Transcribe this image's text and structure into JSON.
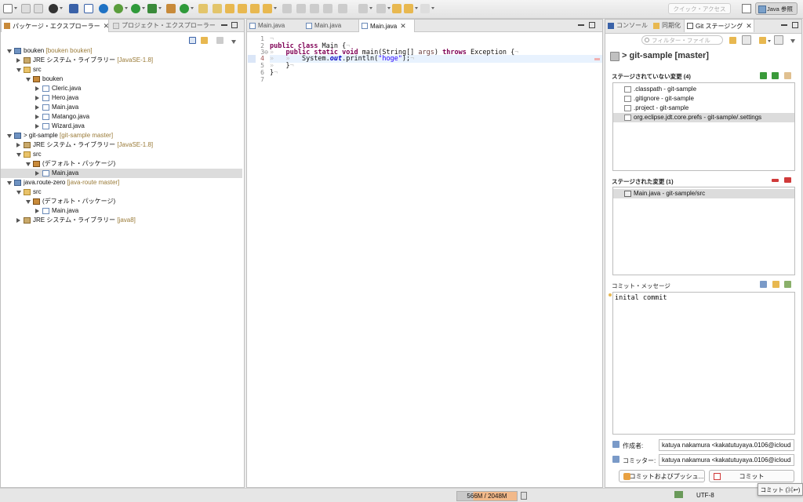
{
  "toolbar": {
    "quick_access": "クイック・アクセス",
    "perspective": "Java 参照"
  },
  "package_explorer": {
    "tab_label": "パッケージ・エクスプローラー",
    "other_tab_label": "プロジェクト・エクスプローラー",
    "tree": [
      {
        "label": "bouken",
        "decoration": " [bouken bouken]"
      },
      {
        "label": "JRE システム・ライブラリー",
        "decoration": " [JavaSE-1.8]"
      },
      {
        "label": "src"
      },
      {
        "label": "bouken"
      },
      {
        "label": "Cleric.java"
      },
      {
        "label": "Hero.java"
      },
      {
        "label": "Main.java"
      },
      {
        "label": "Matango.java"
      },
      {
        "label": "Wizard.java"
      },
      {
        "label": "> git-sample",
        "decoration": " [git-sample master]"
      },
      {
        "label": "JRE システム・ライブラリー",
        "decoration": " [JavaSE-1.8]"
      },
      {
        "label": "src"
      },
      {
        "label": "(デフォルト・パッケージ)"
      },
      {
        "label": "Main.java"
      },
      {
        "label": "java.route-zero",
        "decoration": " [java-route master]"
      },
      {
        "label": "src"
      },
      {
        "label": "(デフォルト・パッケージ)"
      },
      {
        "label": "Main.java"
      },
      {
        "label": "JRE システム・ライブラリー",
        "decoration": " [java8]"
      }
    ]
  },
  "editor": {
    "tabs": [
      "Main.java",
      "Main.java",
      "Main.java"
    ],
    "line_numbers": [
      "1",
      "2",
      "3⊖",
      "4",
      "5",
      "6",
      "7"
    ],
    "code": {
      "l2_kw1": "public",
      "l2_kw2": "class",
      "l2_rest": " Main {",
      "l3_kw1": "public",
      "l3_kw2": "static",
      "l3_kw3": "void",
      "l3_rest1": " main(String[] ",
      "l3_param": "args",
      "l3_rest2": ") ",
      "l3_kw4": "throws",
      "l3_rest3": " Exception {",
      "l4_pre": "System.",
      "l4_field": "out",
      "l4_mid": ".println(",
      "l4_str": "\"hoge\"",
      "l4_end": ");",
      "l5": "}",
      "l6": "}"
    }
  },
  "staging": {
    "tabs": [
      "コンソール",
      "同期化",
      "Git ステージング"
    ],
    "filter_placeholder": "フィルター・ファイル",
    "repo_title": "> git-sample [master]",
    "unstaged_header": "ステージされていない変更 (4)",
    "unstaged": [
      ".classpath - git-sample",
      ".gitignore - git-sample",
      ".project - git-sample",
      "org.eclipse.jdt.core.prefs - git-sample/.settings"
    ],
    "staged_header": "ステージされた変更 (1)",
    "staged": [
      "Main.java - git-sample/src"
    ],
    "commit_message_label": "コミット・メッセージ",
    "commit_message": "inital commit",
    "author_label": "作成者:",
    "author": "katuya nakamura <kakatutuyaya.0106@icloud",
    "committer_label": "コミッター:",
    "committer": "katuya nakamura <kakatutuyaya.0106@icloud",
    "commit_push_label": "コミットおよびプッシュ...",
    "commit_label": "コミット"
  },
  "status_bar": {
    "heap": "566M / 2048M",
    "encoding": "UTF-8",
    "tooltip": "コミット (⌘↩)"
  },
  "colors": {
    "keyword": "#7f0055",
    "string": "#2a00ff",
    "field": "#0000c0",
    "decoration": "#9a7b38",
    "current_line": "#e8f2fe"
  }
}
